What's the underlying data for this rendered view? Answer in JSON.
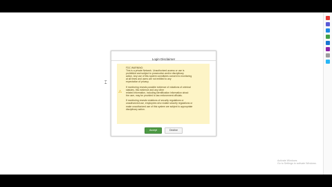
{
  "dialog": {
    "title": "Login Disclaimer",
    "paragraphs": [
      "FDC WARNING:\nThis is a private Network. Unauthorized access or use is\nprohibited and subject to prosecution and/or disciplinary\naction. Any use of this system constitutes consent to monitoring\nat all times and users are not entitled to any\nexpectation of privacy.",
      "If monitoring reveals possible evidence of violations of criminal\nstatutes, this evidence and any other\nrelated information, including identification information about\nthe user, may be provided to law enforcement officials.",
      "If monitoring reveals violations of security regulations or\nunauthorized use, employees who violate security regulations or\nmake unauthorized use of this system are subject to appropriate\ndisciplinary action."
    ],
    "accept_label": "Accept",
    "decline_label": "Decline"
  },
  "watermark": {
    "line1": "Activate Windows",
    "line2": "Go to Settings to activate Windows."
  },
  "colors": {
    "warning_bg": "#fdf4c6",
    "accept_green": "#4e9a45"
  },
  "icons": [
    "warning-icon",
    "mouse-cursor-icon"
  ]
}
